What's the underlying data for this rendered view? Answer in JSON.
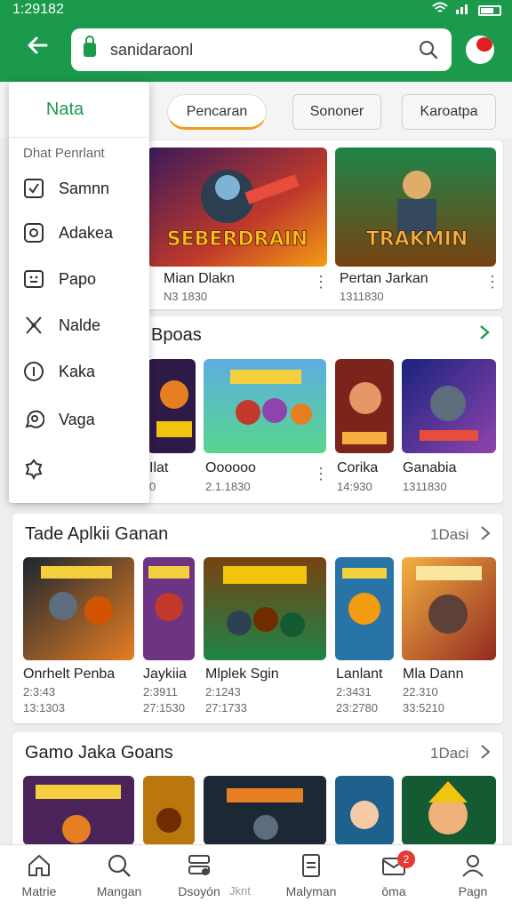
{
  "status": {
    "time": "1:29182"
  },
  "header": {
    "search_text": "sanidaraonl"
  },
  "chips": [
    "Pencaran",
    "Sononer",
    "Karoatpa"
  ],
  "featured": [
    {
      "banner": "SEBERDRAIN",
      "name": "Mian Dlakn",
      "meta": "N3 1830"
    },
    {
      "banner": "TRAKMIN",
      "name": "Pertan Jarkan",
      "meta": "1311830"
    }
  ],
  "section1": {
    "title": "Bpoas",
    "apps": [
      {
        "name": "Ilat",
        "meta": "0"
      },
      {
        "name": "Oooooo",
        "meta": "2.1.1830"
      },
      {
        "name": "Corika",
        "meta": "14:930"
      },
      {
        "name": "Ganabia",
        "meta": "1311830"
      }
    ]
  },
  "section2": {
    "title": "Tade Aplkii Ganan",
    "more": "1Dasi",
    "apps": [
      {
        "name": "Onrhelt Penba",
        "meta1": "2:3:43",
        "meta2": "13:1303"
      },
      {
        "name": "Jaykiia",
        "meta1": "2:3911",
        "meta2": "27:1530"
      },
      {
        "name": "Mlplek Sgin",
        "meta1": "2:1243",
        "meta2": "27:1733"
      },
      {
        "name": "Lanlant",
        "meta1": "2:3431",
        "meta2": "23:2780"
      },
      {
        "name": "Mla Dann",
        "meta1": "22.310",
        "meta2": "33:5210"
      }
    ]
  },
  "section3": {
    "title": "Gamo Jaka Goans",
    "more": "1Daci"
  },
  "drawer": {
    "title": "Nata",
    "subtitle": "Dhat Penrlant",
    "items": [
      "Samnn",
      "Adakea",
      "Papo",
      "Nalde",
      "Kaka",
      "Vaga"
    ]
  },
  "nav": [
    {
      "label": "Matrie",
      "icon": "home-icon"
    },
    {
      "label": "Mangan",
      "icon": "search-icon"
    },
    {
      "label": "Dsoyón",
      "icon": "layers-icon"
    },
    {
      "label": "Malyman",
      "icon": "document-icon"
    },
    {
      "label": "ōma",
      "icon": "mail-icon",
      "badge": "2"
    },
    {
      "label": "Pagn",
      "icon": "person-icon"
    }
  ],
  "extra_nav_text": "Jknt",
  "colors": {
    "brand_green": "#1b9a4b",
    "accent_orange": "#f29b1e",
    "badge_red": "#e53935"
  }
}
